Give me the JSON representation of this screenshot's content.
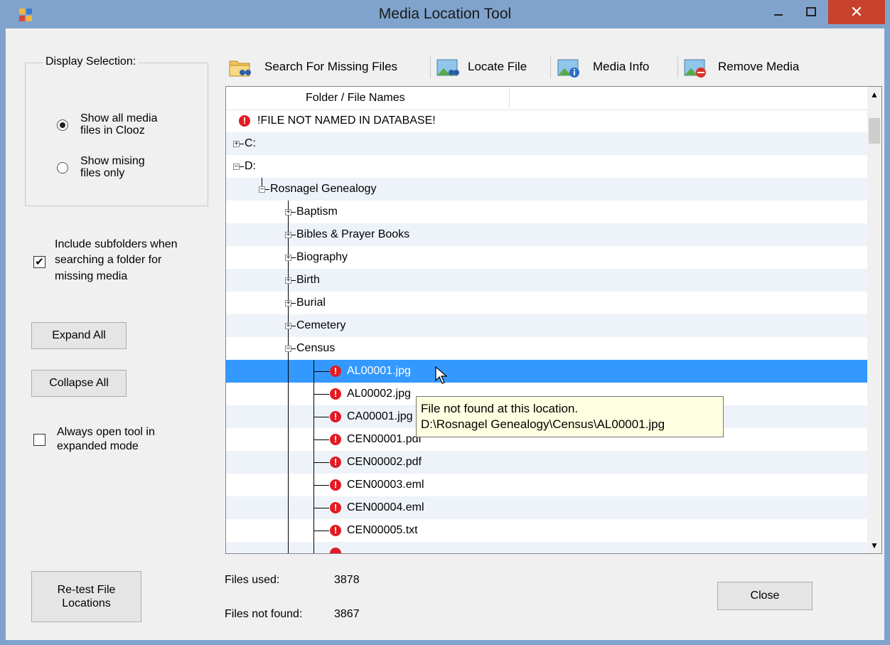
{
  "window": {
    "title": "Media Location Tool",
    "close_glyph": "✕",
    "accent_color": "#3399ff",
    "error_color": "#e31b23"
  },
  "toolbar": {
    "search_label": "Search For Missing Files",
    "locate_label": "Locate File",
    "info_label": "Media Info",
    "remove_label": "Remove Media"
  },
  "display_selection": {
    "legend": "Display Selection:",
    "show_all_line1": "Show all media",
    "show_all_line2": "files in Clooz",
    "show_missing_line1": "Show mising",
    "show_missing_line2": "files only",
    "selected": "show_all"
  },
  "options": {
    "include_subfolders_line1": "Include subfolders when",
    "include_subfolders_line2": "searching a folder for",
    "include_subfolders_line3": "missing media",
    "include_subfolders_checked": true,
    "always_open_line1": "Always open tool in",
    "always_open_line2": "expanded mode",
    "always_open_checked": false
  },
  "buttons": {
    "expand_all": "Expand All",
    "collapse_all": "Collapse All",
    "retest_line1": "Re-test File",
    "retest_line2": "Locations",
    "close": "Close"
  },
  "tree": {
    "column_header": "Folder / File Names",
    "rows": [
      {
        "text": "!FILE NOT NAMED IN DATABASE!",
        "type": "error-root"
      },
      {
        "text": "C:",
        "type": "drive",
        "expander": "+"
      },
      {
        "text": "D:",
        "type": "drive",
        "expander": "−"
      },
      {
        "text": "Rosnagel Genealogy",
        "type": "folder",
        "expander": "−"
      },
      {
        "text": "Baptism",
        "type": "subfolder",
        "expander": "+"
      },
      {
        "text": "Bibles & Prayer Books",
        "type": "subfolder",
        "expander": "+"
      },
      {
        "text": "Biography",
        "type": "subfolder",
        "expander": "+"
      },
      {
        "text": "Birth",
        "type": "subfolder",
        "expander": "+"
      },
      {
        "text": "Burial",
        "type": "subfolder",
        "expander": "+"
      },
      {
        "text": "Cemetery",
        "type": "subfolder",
        "expander": "+"
      },
      {
        "text": "Census",
        "type": "subfolder",
        "expander": "−"
      },
      {
        "text": "AL00001.jpg",
        "type": "file",
        "selected": true
      },
      {
        "text": "AL00002.jpg",
        "type": "file"
      },
      {
        "text": "CA00001.jpg",
        "type": "file"
      },
      {
        "text": "CEN00001.pdf",
        "type": "file"
      },
      {
        "text": "CEN00002.pdf",
        "type": "file"
      },
      {
        "text": "CEN00003.eml",
        "type": "file"
      },
      {
        "text": "CEN00004.eml",
        "type": "file"
      },
      {
        "text": "CEN00005.txt",
        "type": "file"
      }
    ]
  },
  "tooltip": {
    "line1": "File not found at this location.",
    "line2": "D:\\Rosnagel Genealogy\\Census\\AL00001.jpg"
  },
  "status": {
    "files_used_label": "Files used:",
    "files_used_value": "3878",
    "files_not_found_label": "Files not found:",
    "files_not_found_value": "3867"
  },
  "icons": {
    "app": "app-icon",
    "search": "folder-binoculars-icon",
    "locate": "image-binoculars-icon",
    "info": "image-info-icon",
    "remove": "image-remove-icon",
    "error": "error-icon"
  }
}
